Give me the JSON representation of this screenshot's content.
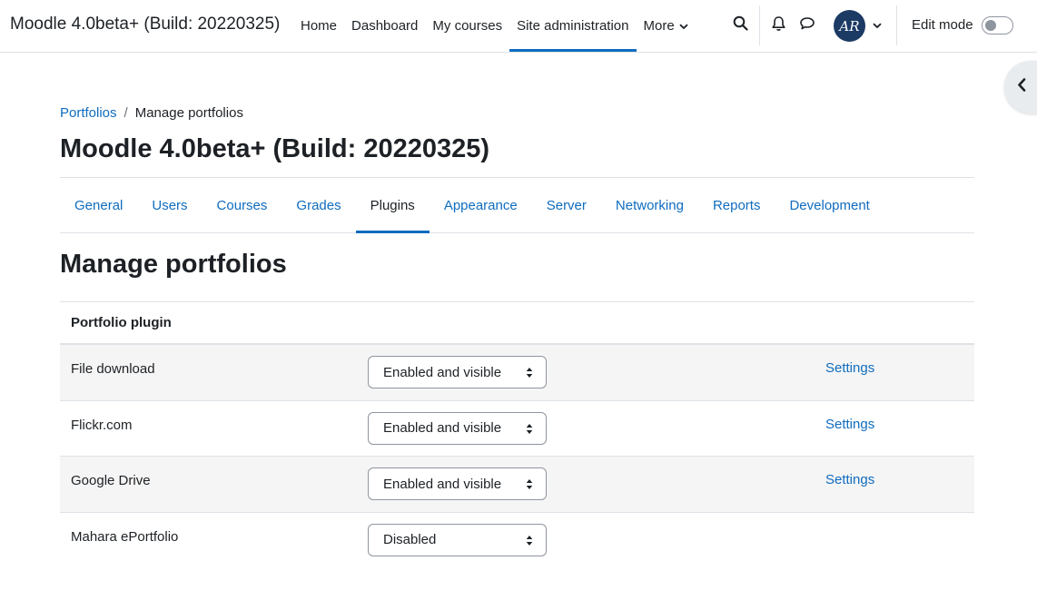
{
  "navbar": {
    "brand": "Moodle 4.0beta+ (Build: 20220325)",
    "items": [
      {
        "label": "Home"
      },
      {
        "label": "Dashboard"
      },
      {
        "label": "My courses"
      },
      {
        "label": "Site administration",
        "active": true
      },
      {
        "label": "More"
      }
    ],
    "user_initials": "AR",
    "edit_mode_label": "Edit mode",
    "edit_mode_on": false
  },
  "breadcrumb": {
    "parent": "Portfolios",
    "separator": "/",
    "current": "Manage portfolios"
  },
  "page_title": "Moodle 4.0beta+ (Build: 20220325)",
  "secondary_nav": {
    "tabs": [
      {
        "label": "General"
      },
      {
        "label": "Users"
      },
      {
        "label": "Courses"
      },
      {
        "label": "Grades"
      },
      {
        "label": "Plugins",
        "active": true
      },
      {
        "label": "Appearance"
      },
      {
        "label": "Server"
      },
      {
        "label": "Networking"
      },
      {
        "label": "Reports"
      },
      {
        "label": "Development"
      }
    ]
  },
  "section_title": "Manage portfolios",
  "table": {
    "header": "Portfolio plugin",
    "rows": [
      {
        "name": "File download",
        "status": "Enabled and visible",
        "settings": "Settings"
      },
      {
        "name": "Flickr.com",
        "status": "Enabled and visible",
        "settings": "Settings"
      },
      {
        "name": "Google Drive",
        "status": "Enabled and visible",
        "settings": "Settings"
      },
      {
        "name": "Mahara ePortfolio",
        "status": "Disabled",
        "settings": ""
      }
    ]
  },
  "colors": {
    "link": "#0f6cbf",
    "text": "#1d2125",
    "border": "#dee2e6",
    "stripe": "#f5f5f5",
    "avatar": "#1b3a64"
  }
}
